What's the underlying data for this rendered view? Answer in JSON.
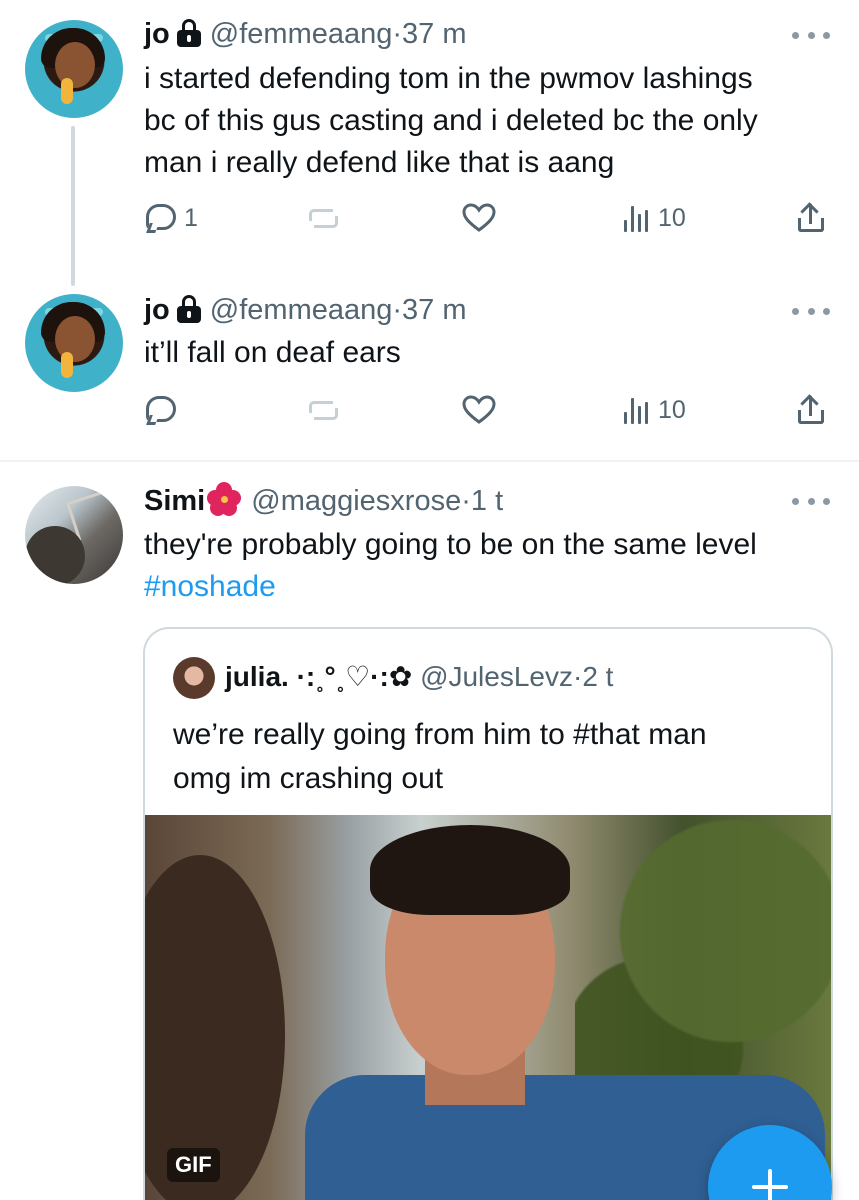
{
  "tweets": [
    {
      "name": "jo",
      "handle": "@femmeaang",
      "time": "37 m",
      "lines": [
        "i started defending tom in the pwmov lashings",
        "bc of this gus casting and i deleted bc the only",
        "man i really defend like that is aang"
      ],
      "replies": "1",
      "views": "10"
    },
    {
      "name": "jo",
      "handle": "@femmeaang",
      "time": "37 m",
      "lines": [
        "it’ll fall on deaf ears"
      ],
      "replies": "",
      "views": "10"
    },
    {
      "name": "Simi",
      "handle": "@maggiesxrose",
      "time": "1 t",
      "lines": [
        "they're probably going to be on the same level"
      ],
      "hashtag": "#noshade",
      "quote": {
        "name": "julia. ·:˳°˳♡·:✿",
        "handle": "@JulesLevz",
        "time": "2 t",
        "lines": [
          "we’re really going from him to #that man",
          "omg im crashing out"
        ],
        "media_badge": "GIF"
      }
    }
  ],
  "separator": "·",
  "colors": {
    "accent": "#1d9bf0",
    "text": "#0f1419",
    "secondary": "#536471",
    "divider": "#eff3f4"
  },
  "icons": {
    "reply": "reply-icon",
    "retweet": "retweet-icon",
    "like": "heart-icon",
    "views": "views-icon",
    "share": "share-icon",
    "more": "more-icon",
    "lock": "lock-icon",
    "compose": "plus-icon"
  }
}
